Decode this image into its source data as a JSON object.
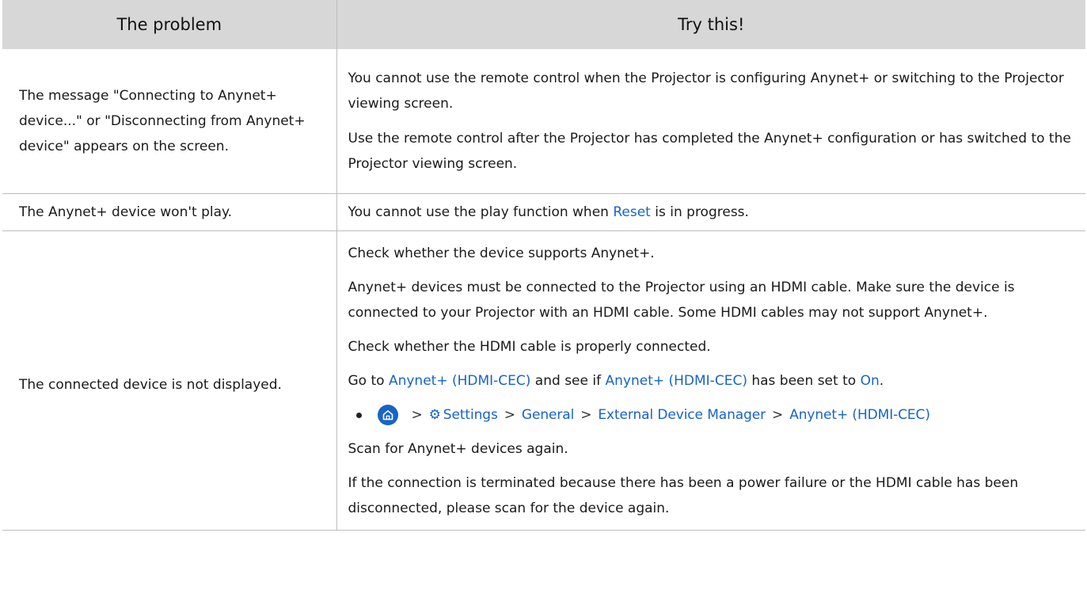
{
  "header": {
    "col1": "The problem",
    "col2": "Try this!"
  },
  "rows": [
    {
      "problem": "The message \"Connecting to Anynet+ device...\" or \"Disconnecting from Anynet+ device\" appears on the screen.",
      "solutions": [
        "You cannot use the remote control when the Projector is configuring Anynet+ or switching to the Projector viewing screen.",
        "Use the remote control after the Projector has completed the Anynet+ configuration or has switched to the Projector viewing screen."
      ]
    },
    {
      "problem": "The Anynet+ device won't play.",
      "solution_before": "You cannot use the play function when ",
      "solution_link": "Reset",
      "solution_after": " is in progress."
    },
    {
      "problem": "The connected device is not displayed.",
      "p1": "Check whether the device supports Anynet+.",
      "p2": "Anynet+ devices must be connected to the Projector using an HDMI cable. Make sure the device is connected to your Projector with an HDMI cable. Some HDMI cables may not support Anynet+.",
      "p3": "Check whether the HDMI cable is properly connected.",
      "p4": {
        "t1": "Go to ",
        "l1": "Anynet+ (HDMI-CEC)",
        "t2": " and see if ",
        "l2": "Anynet+ (HDMI-CEC)",
        "t3": " has been set to ",
        "l3": "On",
        "t4": "."
      },
      "path": {
        "home_icon": "home-icon",
        "gear_icon": "gear-icon",
        "separator": ">",
        "items": [
          "Settings",
          "General",
          "External Device Manager",
          "Anynet+ (HDMI-CEC)"
        ]
      },
      "p5": "Scan for Anynet+ devices again.",
      "p6": "If the connection is terminated because there has been a power failure or the HDMI cable has been disconnected, please scan for the device again."
    }
  ],
  "colors": {
    "link": "#1863c6",
    "header_bg": "#d7d7d7"
  }
}
